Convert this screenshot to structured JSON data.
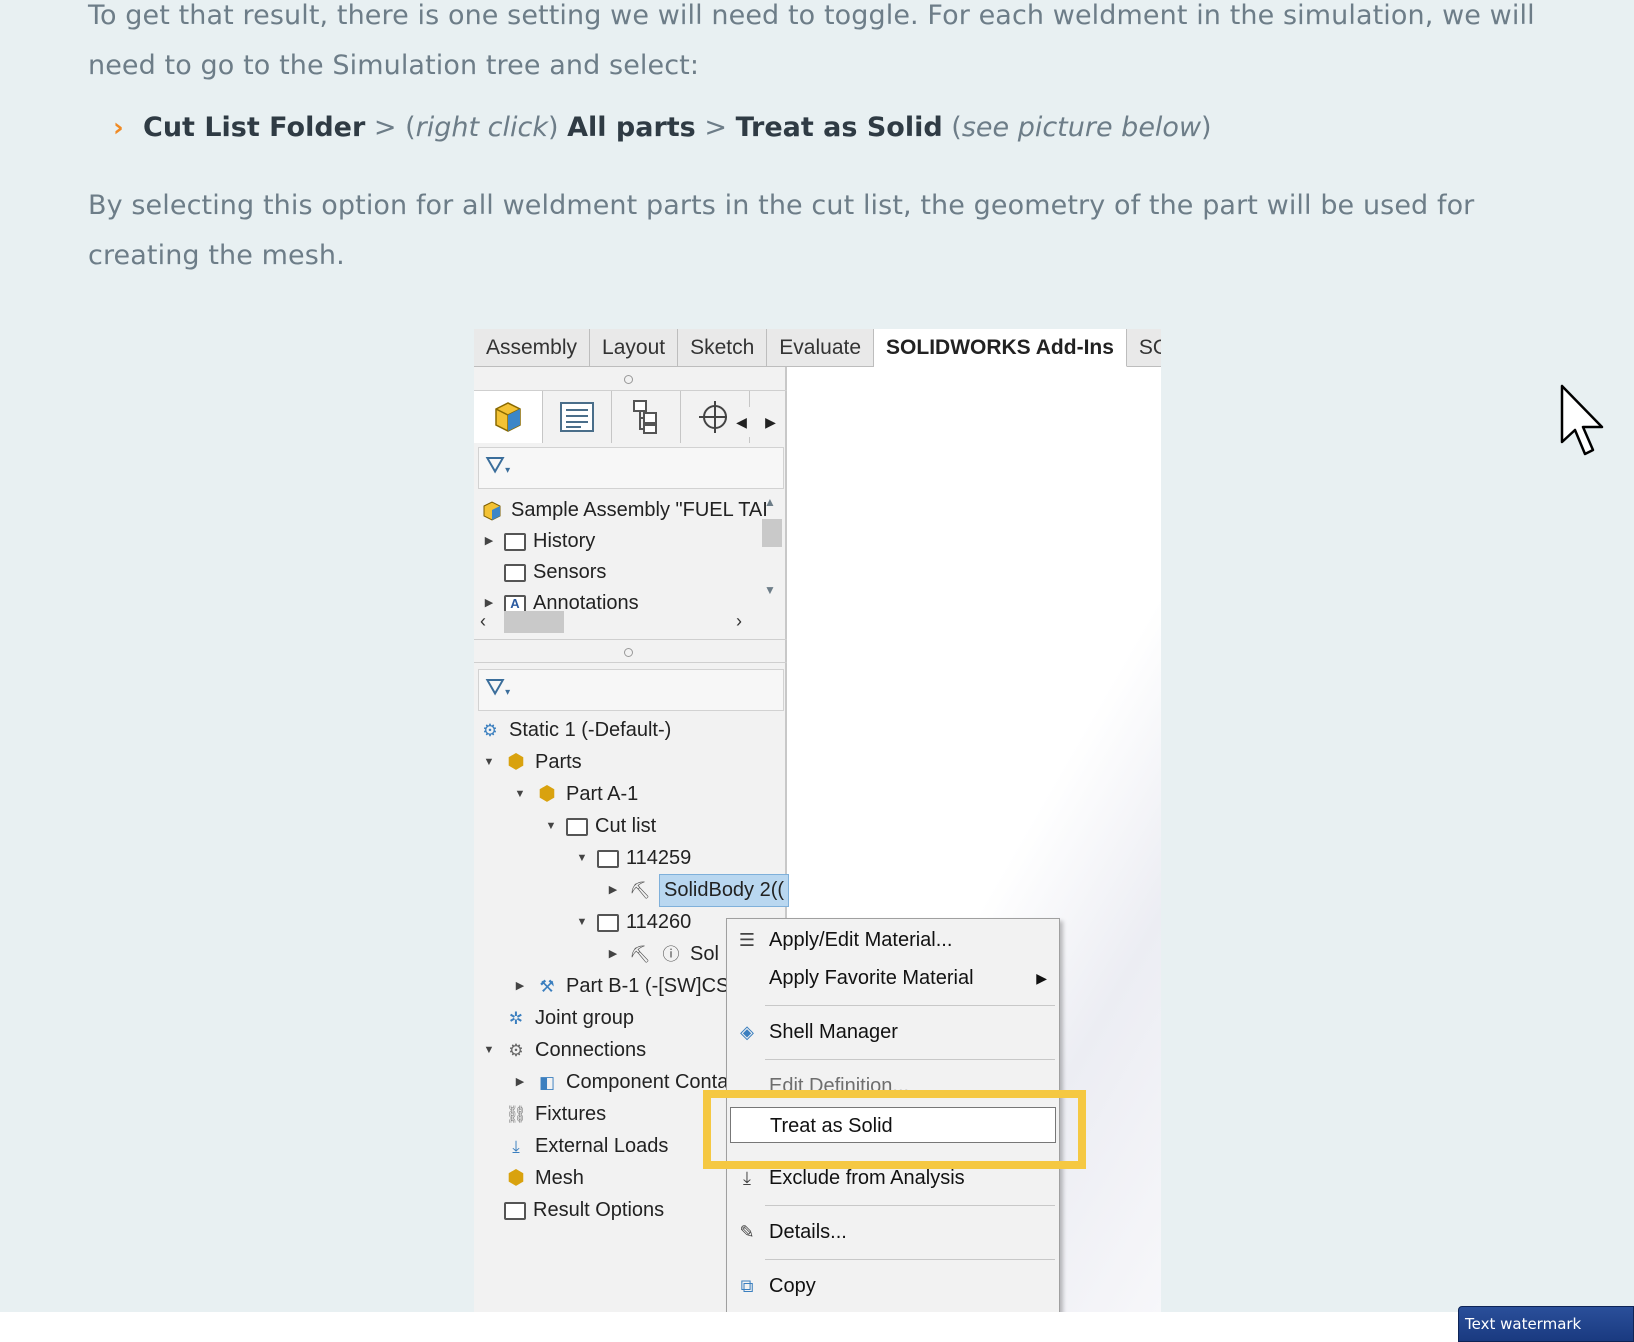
{
  "article": {
    "para1": "To get that result, there is one setting we will need to toggle. For each weldment in the simulation, we will need to go to the Simulation tree and select:",
    "bullet": {
      "b1": "Cut List Folder",
      "sep1": " > (",
      "i1": "right click",
      "sep2": ") ",
      "b2": "All parts",
      "sep3": " > ",
      "b3": "Treat as Solid",
      "sep4": " (",
      "i2": "see picture below",
      "sep5": ")"
    },
    "para2": "By selecting this option for all weldment parts in the cut list, the geometry of the part will be used for creating the mesh."
  },
  "screenshot": {
    "tabs": [
      "Assembly",
      "Layout",
      "Sketch",
      "Evaluate",
      "SOLIDWORKS Add-Ins",
      "SOLI"
    ],
    "active_tab": "SOLIDWORKS Add-Ins",
    "feature_tree": [
      {
        "label": "Sample Assembly \"FUEL TAI",
        "icon": "assembly-icon"
      },
      {
        "label": "History",
        "icon": "history-icon"
      },
      {
        "label": "Sensors",
        "icon": "sensor-icon"
      },
      {
        "label": "Annotations",
        "icon": "annotation-icon"
      }
    ],
    "sim_tree": [
      {
        "label": "Static 1 (-Default-)"
      },
      {
        "label": "Parts"
      },
      {
        "label": "Part A-1"
      },
      {
        "label": "Cut list"
      },
      {
        "label": "114259"
      },
      {
        "label": "SolidBody 2(("
      },
      {
        "label": "114260"
      },
      {
        "label": "Sol"
      },
      {
        "label": "Part B-1 (-[SW]CS"
      },
      {
        "label": "Joint group"
      },
      {
        "label": "Connections"
      },
      {
        "label": "Component Conta"
      },
      {
        "label": "Fixtures"
      },
      {
        "label": "External Loads"
      },
      {
        "label": "Mesh"
      },
      {
        "label": "Result Options"
      }
    ],
    "context_menu": [
      {
        "label": "Apply/Edit Material...",
        "icon": "material-list-icon"
      },
      {
        "label": "Apply Favorite Material",
        "icon": ""
      },
      {
        "label": "Shell Manager",
        "icon": "shell-icon"
      },
      {
        "label": "Edit Definition...",
        "icon": ""
      },
      {
        "label": "Treat as Solid",
        "icon": ""
      },
      {
        "label": "Exclude from Analysis",
        "icon": "exclude-icon"
      },
      {
        "label": "Details...",
        "icon": "details-icon"
      },
      {
        "label": "Copy",
        "icon": "copy-icon"
      }
    ],
    "highlight_color": "#f5c842"
  },
  "watermark": "Text watermark"
}
